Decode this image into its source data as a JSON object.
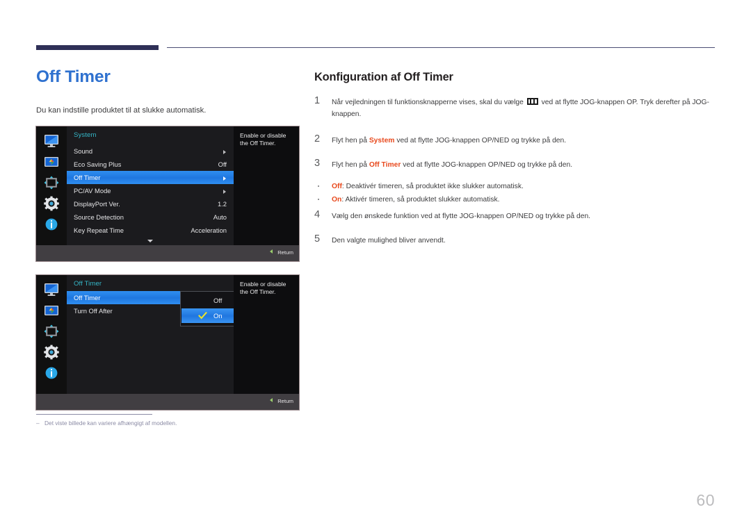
{
  "document": {
    "page_number": "60",
    "footnote": "Det viste billede kan variere afhængigt af modellen."
  },
  "left_column": {
    "title": "Off Timer",
    "lead": "Du kan indstille produktet til at slukke automatisk."
  },
  "right_column": {
    "title": "Konfiguration af Off Timer",
    "steps": [
      {
        "number": "1",
        "text_before": "Når vejledningen til funktionsknapperne vises, skal du vælge",
        "icon": "jog-menu-icon",
        "text_after": "ved at flytte JOG-knappen OP. Tryk derefter på JOG-knappen."
      },
      {
        "number": "2",
        "prefix": "Flyt hen på ",
        "emphasis": "System",
        "suffix": " ved at flytte JOG-knappen OP/NED og trykke på den."
      },
      {
        "number": "3",
        "prefix": "Flyt hen på ",
        "emphasis": "Off Timer",
        "suffix": " ved at flytte JOG-knappen OP/NED og trykke på den."
      },
      {
        "number": "4",
        "prefix": "",
        "emphasis": "",
        "suffix": "Vælg den ønskede funktion ved at flytte JOG-knappen OP/NED og trykke på den."
      },
      {
        "number": "5",
        "prefix": "",
        "emphasis": "",
        "suffix": "Den valgte mulighed bliver anvendt."
      }
    ],
    "bullets": [
      {
        "emphasis": "Off",
        "text": ": Deaktivér timeren, så produktet ikke slukker automatisk."
      },
      {
        "emphasis": "On",
        "text": ": Aktivér timeren, så produktet slukker automatisk."
      }
    ]
  },
  "osd_1": {
    "heading": "System",
    "rows": [
      {
        "label": "Sound",
        "value": "",
        "arrow": true
      },
      {
        "label": "Eco Saving Plus",
        "value": "Off",
        "arrow": false
      },
      {
        "label": "Off Timer",
        "value": "",
        "arrow": true,
        "selected": true
      },
      {
        "label": "PC/AV Mode",
        "value": "",
        "arrow": true
      },
      {
        "label": "DisplayPort Ver.",
        "value": "1.2",
        "arrow": false
      },
      {
        "label": "Source Detection",
        "value": "Auto",
        "arrow": false
      },
      {
        "label": "Key Repeat Time",
        "value": "Acceleration",
        "arrow": false
      }
    ],
    "info": "Enable or disable the Off Timer.",
    "return_label": "Return",
    "rail_icons": [
      "monitor-icon",
      "picture-icon",
      "move-arrows-icon",
      "gear-icon",
      "info-icon"
    ]
  },
  "osd_2": {
    "heading": "Off Timer",
    "rows": [
      {
        "label": "Off Timer",
        "value": "",
        "arrow": false,
        "selected": true
      },
      {
        "label": "Turn Off After",
        "value": "",
        "arrow": false
      }
    ],
    "dropdown": [
      {
        "label": "Off",
        "selected": false,
        "checked": false
      },
      {
        "label": "On",
        "selected": true,
        "checked": true
      }
    ],
    "info": "Enable or disable the Off Timer.",
    "return_label": "Return",
    "rail_icons": [
      "monitor-icon",
      "picture-icon",
      "move-arrows-icon",
      "gear-icon",
      "info-icon"
    ]
  },
  "colors": {
    "title_blue": "#2f71cf",
    "header_navy": "#2f3057",
    "emphasis_orange": "#e8491d",
    "osd_heading_teal": "#35b7c8",
    "osd_highlight_blue": "#2076e0"
  }
}
